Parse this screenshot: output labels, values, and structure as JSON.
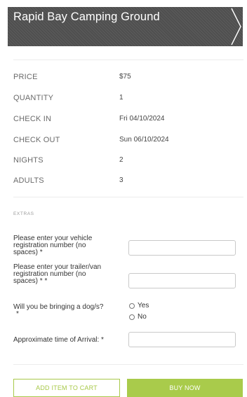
{
  "header": {
    "title": "Rapid Bay Camping Ground"
  },
  "details": [
    {
      "label": "PRICE",
      "value": "$75"
    },
    {
      "label": "QUANTITY",
      "value": "1"
    },
    {
      "label": "CHECK IN",
      "value": "Fri 04/10/2024"
    },
    {
      "label": "CHECK OUT",
      "value": "Sun 06/10/2024"
    },
    {
      "label": "NIGHTS",
      "value": "2"
    },
    {
      "label": "ADULTS",
      "value": "3"
    }
  ],
  "extras": {
    "heading": "EXTRAS",
    "vehicle_label_l1": "Please enter your vehicle",
    "vehicle_label_l2": "registration number (no",
    "vehicle_label_l3": "spaces)  *",
    "vehicle_value": "",
    "trailer_label_l1": "Please enter your trailer/van",
    "trailer_label_l2": "registration number (no",
    "trailer_label_l3": "spaces) * *",
    "trailer_value": "",
    "dog_label_l1": "Will you be bringing a dog/s?",
    "dog_label_l2": "*",
    "dog_options": [
      "Yes",
      "No"
    ],
    "arrival_label": "Approximate time of Arrival: *",
    "arrival_value": ""
  },
  "actions": {
    "add_to_cart": "ADD ITEM TO CART",
    "buy_now": "BUY NOW"
  }
}
